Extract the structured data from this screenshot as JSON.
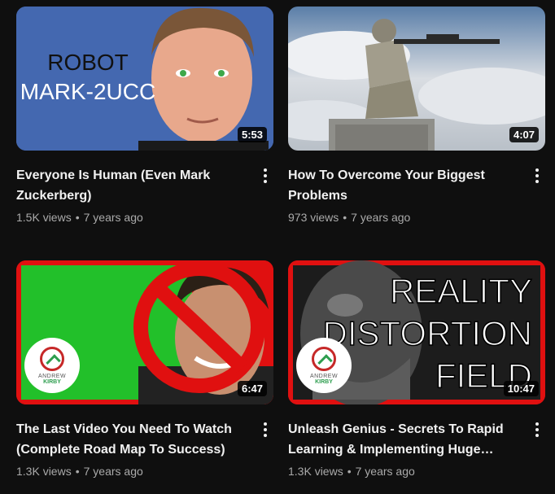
{
  "videos": [
    {
      "title": "Everyone Is Human (Even Mark Zuckerberg)",
      "views": "1.5K views",
      "age": "7 years ago",
      "duration": "5:53",
      "thumb_text_line1": "ROBOT",
      "thumb_text_line2": "MARK-2UCC"
    },
    {
      "title": "How To Overcome Your Biggest Problems",
      "views": "973 views",
      "age": "7 years ago",
      "duration": "4:07"
    },
    {
      "title": "The Last Video You Need To Watch (Complete Road Map To Success)",
      "views": "1.3K views",
      "age": "7 years ago",
      "duration": "6:47",
      "logo_line1": "ANDREW",
      "logo_line2": "KIRBY"
    },
    {
      "title": "Unleash Genius - Secrets To Rapid Learning & Implementing Huge…",
      "views": "1.3K views",
      "age": "7 years ago",
      "duration": "10:47",
      "thumb_text_line1": "REALITY",
      "thumb_text_line2": "DISTORTION",
      "thumb_text_line3": "FIELD",
      "logo_line1": "ANDREW",
      "logo_line2": "KIRBY"
    }
  ],
  "separator": "•",
  "colors": {
    "background": "#0f0f0f",
    "accent_red": "#e01010",
    "green_screen": "#22c02a",
    "thumb_blue": "#4468b0"
  }
}
